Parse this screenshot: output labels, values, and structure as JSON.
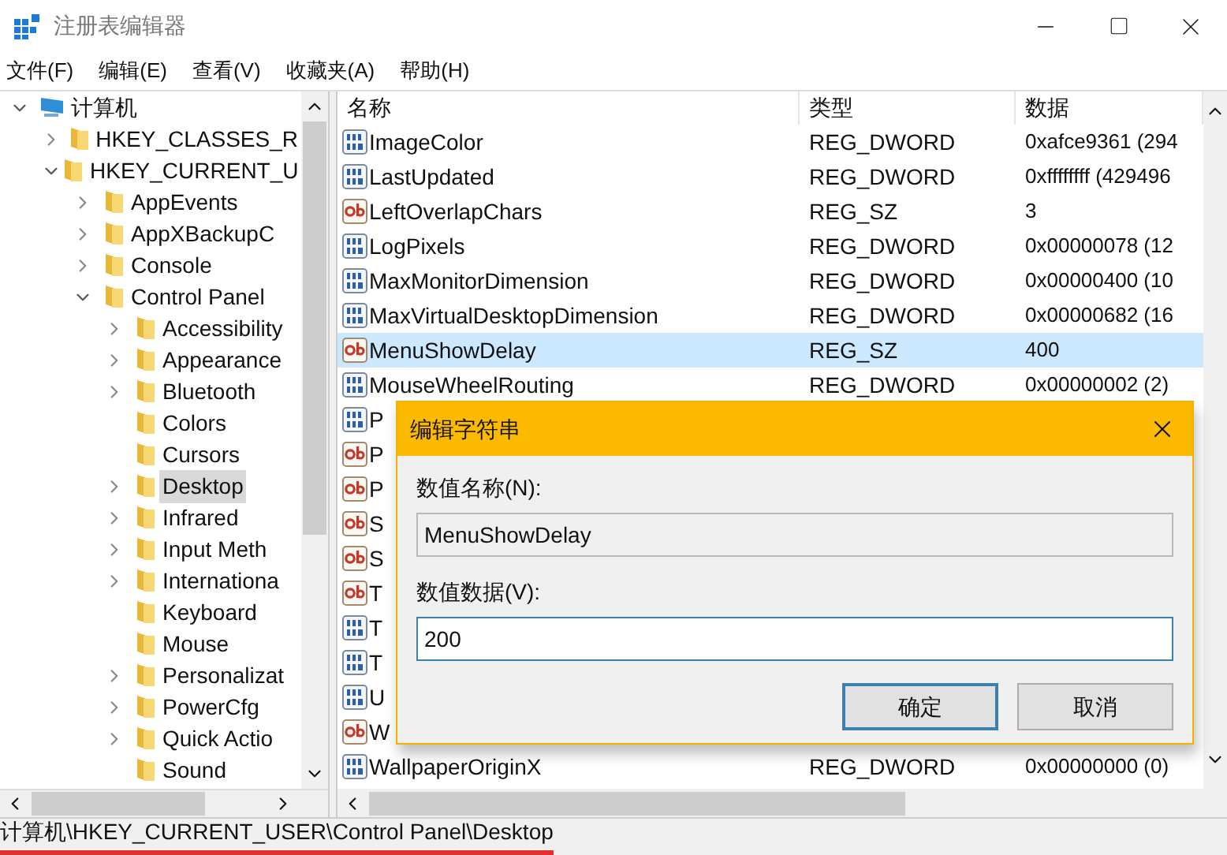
{
  "window": {
    "title": "注册表编辑器"
  },
  "menu": [
    "文件(F)",
    "编辑(E)",
    "查看(V)",
    "收藏夹(A)",
    "帮助(H)"
  ],
  "tree": [
    {
      "label": "计算机",
      "kind": "computer",
      "expanded": true,
      "selected": false,
      "children": [
        {
          "label": "HKEY_CLASSES_R",
          "kind": "folder",
          "expanded": false,
          "selected": false
        },
        {
          "label": "HKEY_CURRENT_U",
          "kind": "folder",
          "expanded": true,
          "selected": false,
          "children": [
            {
              "label": "AppEvents",
              "kind": "folder",
              "expanded": false,
              "selected": false
            },
            {
              "label": "AppXBackupC",
              "kind": "folder",
              "expanded": false,
              "selected": false
            },
            {
              "label": "Console",
              "kind": "folder",
              "expanded": false,
              "selected": false
            },
            {
              "label": "Control Panel",
              "kind": "folder",
              "expanded": true,
              "selected": false,
              "children": [
                {
                  "label": "Accessibility",
                  "kind": "folder",
                  "expanded": false,
                  "selected": false
                },
                {
                  "label": "Appearance",
                  "kind": "folder",
                  "expanded": false,
                  "selected": false
                },
                {
                  "label": "Bluetooth",
                  "kind": "folder",
                  "expanded": false,
                  "selected": false
                },
                {
                  "label": "Colors",
                  "kind": "folder",
                  "selected": false
                },
                {
                  "label": "Cursors",
                  "kind": "folder",
                  "selected": false
                },
                {
                  "label": "Desktop",
                  "kind": "folder",
                  "expanded": false,
                  "selected": true
                },
                {
                  "label": "Infrared",
                  "kind": "folder",
                  "expanded": false,
                  "selected": false
                },
                {
                  "label": "Input Meth",
                  "kind": "folder",
                  "expanded": false,
                  "selected": false
                },
                {
                  "label": "Internationa",
                  "kind": "folder",
                  "expanded": false,
                  "selected": false
                },
                {
                  "label": "Keyboard",
                  "kind": "folder",
                  "selected": false
                },
                {
                  "label": "Mouse",
                  "kind": "folder",
                  "selected": false
                },
                {
                  "label": "Personalizat",
                  "kind": "folder",
                  "expanded": false,
                  "selected": false
                },
                {
                  "label": "PowerCfg",
                  "kind": "folder",
                  "expanded": false,
                  "selected": false
                },
                {
                  "label": "Quick Actio",
                  "kind": "folder",
                  "expanded": false,
                  "selected": false
                },
                {
                  "label": "Sound",
                  "kind": "folder",
                  "selected": false
                }
              ]
            }
          ]
        }
      ]
    }
  ],
  "table": {
    "columns": [
      "名称",
      "类型",
      "数据"
    ],
    "rows": [
      {
        "kind": "dword",
        "name": "ImageColor",
        "type": "REG_DWORD",
        "data": "0xafce9361 (294",
        "selected": false
      },
      {
        "kind": "dword",
        "name": "LastUpdated",
        "type": "REG_DWORD",
        "data": "0xffffffff (429496",
        "selected": false
      },
      {
        "kind": "sz",
        "name": "LeftOverlapChars",
        "type": "REG_SZ",
        "data": "3",
        "selected": false
      },
      {
        "kind": "dword",
        "name": "LogPixels",
        "type": "REG_DWORD",
        "data": "0x00000078 (12",
        "selected": false
      },
      {
        "kind": "dword",
        "name": "MaxMonitorDimension",
        "type": "REG_DWORD",
        "data": "0x00000400 (10",
        "selected": false
      },
      {
        "kind": "dword",
        "name": "MaxVirtualDesktopDimension",
        "type": "REG_DWORD",
        "data": "0x00000682 (16",
        "selected": false
      },
      {
        "kind": "sz",
        "name": "MenuShowDelay",
        "type": "REG_SZ",
        "data": "400",
        "selected": true
      },
      {
        "kind": "dword",
        "name": "MouseWheelRouting",
        "type": "REG_DWORD",
        "data": "0x00000002 (2)",
        "selected": false
      },
      {
        "kind": "dword",
        "name": "P",
        "selected": false
      },
      {
        "kind": "sz",
        "name": "P",
        "selected": false
      },
      {
        "kind": "sz",
        "name": "P",
        "selected": false
      },
      {
        "kind": "sz",
        "name": "S",
        "selected": false
      },
      {
        "kind": "sz",
        "name": "S",
        "selected": false
      },
      {
        "kind": "sz",
        "name": "T",
        "selected": false
      },
      {
        "kind": "dword",
        "name": "T",
        "selected": false
      },
      {
        "kind": "dword",
        "name": "T",
        "selected": false
      },
      {
        "kind": "dword",
        "name": "U",
        "selected": false
      },
      {
        "kind": "sz",
        "name": "W",
        "selected": false
      },
      {
        "kind": "dword",
        "name": "WallpaperOriginX",
        "type": "REG_DWORD",
        "data": "0x00000000 (0)",
        "selected": false
      }
    ]
  },
  "dialog": {
    "title": "编辑字符串",
    "fields": [
      {
        "label": "数值名称(N):",
        "value": "MenuShowDelay",
        "readonly": true,
        "focused": false
      },
      {
        "label": "数值数据(V):",
        "value": "200",
        "readonly": false,
        "focused": true
      }
    ],
    "buttons": [
      {
        "label": "确定",
        "default": true
      },
      {
        "label": "取消",
        "default": false
      }
    ]
  },
  "status_bar": {
    "path": "计算机\\HKEY_CURRENT_USER\\Control Panel\\Desktop",
    "underlined": true
  }
}
